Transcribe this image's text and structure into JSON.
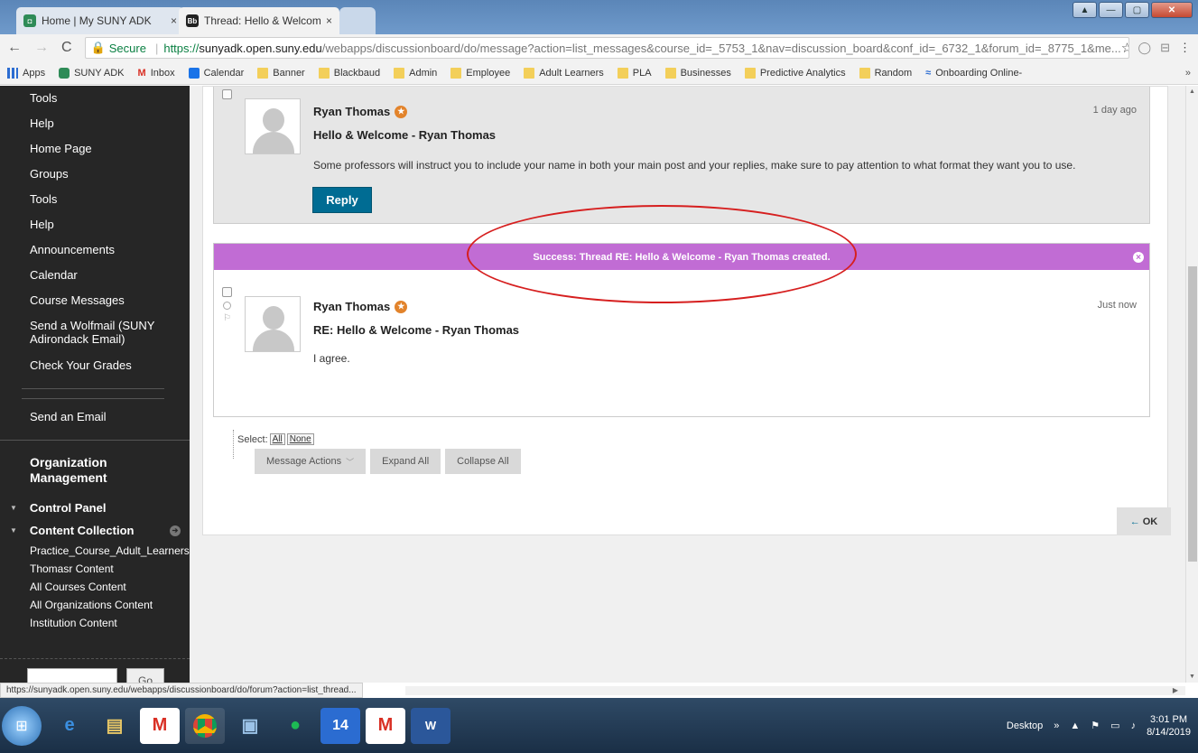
{
  "browser": {
    "tabs": [
      {
        "title": "Home | My SUNY ADK",
        "close": "×"
      },
      {
        "title": "Thread: Hello & Welcome",
        "close": "×"
      }
    ],
    "url": {
      "secure_label": "Secure",
      "scheme": "https://",
      "host": "sunyadk.open.suny.edu",
      "path": "/webapps/discussionboard/do/message?action=list_messages&course_id=_5753_1&nav=discussion_board&conf_id=_6732_1&forum_id=_8775_1&me..."
    },
    "bookmarks": [
      {
        "label": "Apps",
        "icon": "apps-grid-icon"
      },
      {
        "label": "SUNY ADK",
        "icon": "suny-icon"
      },
      {
        "label": "Inbox",
        "icon": "gmail-icon"
      },
      {
        "label": "Calendar",
        "icon": "calendar-icon"
      },
      {
        "label": "Banner",
        "icon": "folder-icon"
      },
      {
        "label": "Blackbaud",
        "icon": "folder-icon"
      },
      {
        "label": "Admin",
        "icon": "folder-icon"
      },
      {
        "label": "Employee",
        "icon": "folder-icon"
      },
      {
        "label": "Adult Learners",
        "icon": "folder-icon"
      },
      {
        "label": "PLA",
        "icon": "folder-icon"
      },
      {
        "label": "Businesses",
        "icon": "folder-icon"
      },
      {
        "label": "Predictive Analytics",
        "icon": "folder-icon"
      },
      {
        "label": "Random",
        "icon": "folder-icon"
      },
      {
        "label": "Onboarding Online-",
        "icon": "bookmark-icon"
      }
    ],
    "more": "»",
    "status_url": "https://sunyadk.open.suny.edu/webapps/discussionboard/do/forum?action=list_thread..."
  },
  "sidebar": {
    "items": [
      "Tools",
      "Help",
      "Home Page",
      "Groups",
      "Tools",
      "Help",
      "Announcements",
      "Calendar",
      "Course Messages",
      "Send a Wolfmail (SUNY Adirondack Email)",
      "Check Your Grades"
    ],
    "send_email": "Send an Email",
    "org_title": "Organization Management",
    "control_panel": "Control Panel",
    "content_collection": "Content Collection",
    "collection_items": [
      "Practice_Course_Adult_Learners",
      "Thomasr Content",
      "All Courses Content",
      "All Organizations Content",
      "Institution Content"
    ],
    "go_label": "Go"
  },
  "thread": {
    "post1": {
      "author": "Ryan Thomas",
      "subject": "Hello & Welcome - Ryan Thomas",
      "body": "Some professors will instruct you to include your name in both your main post and your replies, make sure to pay attention to what format they want you to use.",
      "time": "1 day ago",
      "reply_label": "Reply"
    },
    "success_message": "Success: Thread RE: Hello & Welcome - Ryan Thomas created.",
    "post2": {
      "author": "Ryan Thomas",
      "subject": "RE: Hello & Welcome - Ryan Thomas",
      "body": "I agree.",
      "time": "Just now"
    },
    "select_label": "Select:",
    "select_all": "All",
    "select_none": "None",
    "actions": [
      "Message Actions",
      "Expand All",
      "Collapse All"
    ],
    "ok_label": "OK",
    "ok_arrow": "←"
  },
  "taskbar": {
    "desktop_label": "Desktop",
    "time": "3:01 PM",
    "date": "8/14/2019",
    "calendar_day": "14",
    "chevron": "»"
  }
}
